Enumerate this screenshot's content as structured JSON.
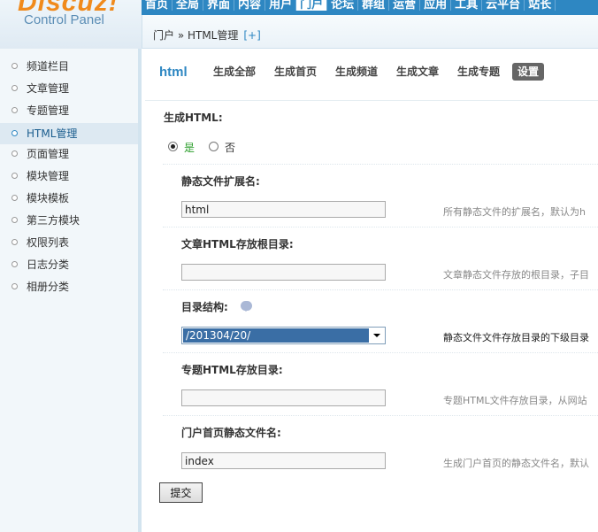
{
  "logo": {
    "main": "Discuz!",
    "sub": "Control Panel"
  },
  "topnav": [
    "首页",
    "全局",
    "界面",
    "内容",
    "用户",
    "门户",
    "论坛",
    "群组",
    "运营",
    "应用",
    "工具",
    "云平台",
    "站长"
  ],
  "breadcrumb": {
    "text": "门户 » HTML管理",
    "add": "[+]"
  },
  "sidebar": [
    "频道栏目",
    "文章管理",
    "专题管理",
    "HTML管理",
    "页面管理",
    "模块管理",
    "模块模板",
    "第三方模块",
    "权限列表",
    "日志分类",
    "相册分类"
  ],
  "sidebar_active": "HTML管理",
  "tabs": {
    "title": "html",
    "items": [
      "生成全部",
      "生成首页",
      "生成频道",
      "生成文章",
      "生成专题",
      "设置"
    ],
    "active": "设置"
  },
  "form": {
    "generate_label": "生成HTML:",
    "yes": "是",
    "no": "否",
    "ext_label": "静态文件扩展名:",
    "ext_value": "html",
    "ext_hint": "所有静态文件的扩展名，默认为h",
    "article_root_label": "文章HTML存放根目录:",
    "article_root_value": "",
    "article_root_hint": "文章静态文件存放的根目录，子目",
    "dir_struct_label": "目录结构:",
    "dir_struct_value": "/201304/20/",
    "dir_struct_hint": "静态文件文件存放目录的下级目录",
    "topic_dir_label": "专题HTML存放目录:",
    "topic_dir_value": "",
    "topic_dir_hint": "专题HTML文件存放目录，从网站",
    "index_name_label": "门户首页静态文件名:",
    "index_name_value": "index",
    "index_name_hint": "生成门户首页的静态文件名，默认",
    "submit": "提交"
  }
}
